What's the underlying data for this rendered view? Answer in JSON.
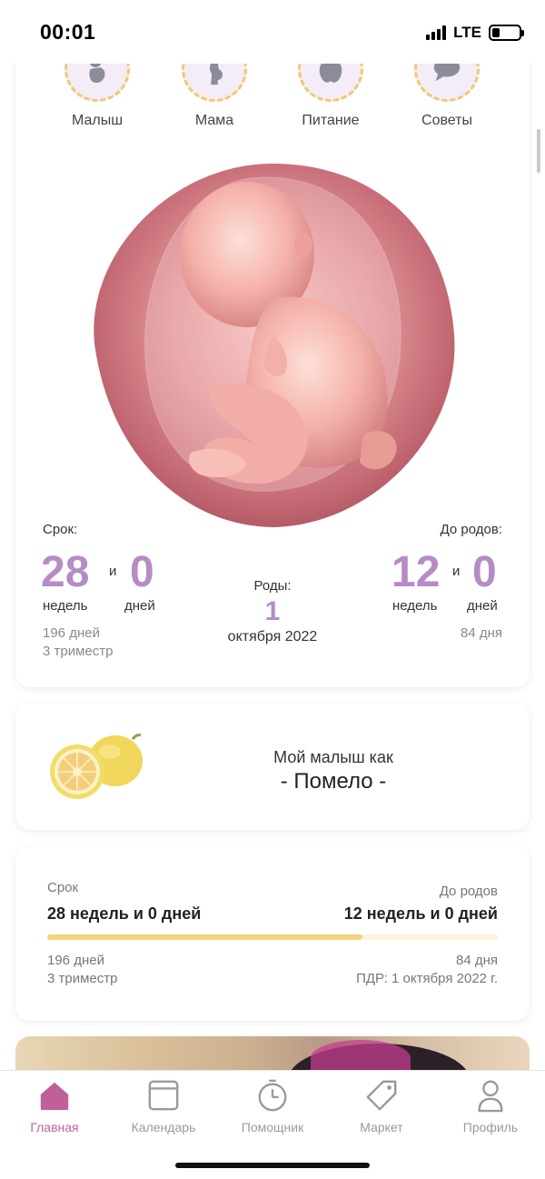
{
  "status_bar": {
    "time": "00:01",
    "network": "LTE",
    "battery_level": 0.3
  },
  "quick_nav": [
    {
      "label": "Малыш",
      "icon": "baby-icon"
    },
    {
      "label": "Мама",
      "icon": "pregnant-mother-icon"
    },
    {
      "label": "Питание",
      "icon": "apple-icon"
    },
    {
      "label": "Советы",
      "icon": "speech-bubble-icon"
    }
  ],
  "pregnancy": {
    "term_label": "Срок:",
    "term_weeks": "28",
    "term_days": "0",
    "conj": "и",
    "weeks_unit": "недель",
    "days_unit": "дней",
    "total_days": "196 дней",
    "trimester": "3 триместр",
    "birth_label": "Роды:",
    "birth_day": "1",
    "birth_month": "октября 2022",
    "remaining_label": "До родов:",
    "remaining_weeks": "12",
    "remaining_days": "0",
    "remaining_total_days": "84 дня"
  },
  "fruit": {
    "intro": "Мой малыш как",
    "name": "- Помело -"
  },
  "progress": {
    "term_label": "Срок",
    "term_value": "28 недель и 0 дней",
    "remaining_label": "До родов",
    "remaining_value": "12 недель и 0 дней",
    "progress_fraction": 0.7,
    "days": "196 дней",
    "trimester": "3 триместр",
    "remaining_days": "84 дня",
    "due_date": "ПДР: 1 октября 2022 г."
  },
  "tabbar": {
    "tabs": [
      {
        "label": "Главная",
        "icon": "home-icon",
        "active": true
      },
      {
        "label": "Календарь",
        "icon": "calendar-icon",
        "active": false
      },
      {
        "label": "Помощник",
        "icon": "timer-icon",
        "active": false
      },
      {
        "label": "Маркет",
        "icon": "price-tag-icon",
        "active": false
      },
      {
        "label": "Профиль",
        "icon": "profile-icon",
        "active": false
      }
    ]
  },
  "colors": {
    "accent": "#b58cc6",
    "tab_active": "#c0609a",
    "progress": "#f2d37a"
  }
}
